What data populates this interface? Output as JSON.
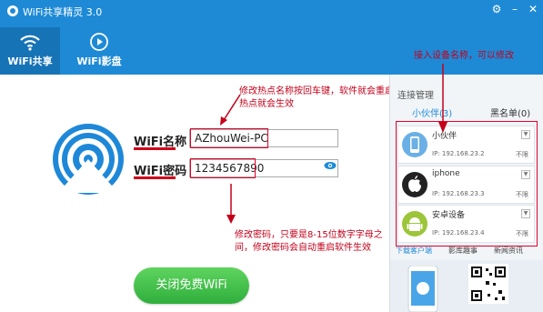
{
  "app": {
    "title": "WiFi共享精灵 3.0"
  },
  "nav": {
    "tabs": [
      {
        "label": "WiFi共享"
      },
      {
        "label": "WiFi影盘"
      }
    ]
  },
  "hotspot": {
    "name_label": "WiFi名称",
    "name_value": "AZhouWei-PC",
    "password_label": "WiFi密码",
    "password_value": "1234567890"
  },
  "annotations": {
    "name_hint": "修改热点名称按回车键，软件就会重启热点就会生效",
    "password_hint": "修改密码，只要是8-15位数字字母之间，修改密码会自动重启软件生效",
    "devices_hint": "接入设备名称，可以修改"
  },
  "actions": {
    "close_label": "关闭免费WiFi"
  },
  "panel": {
    "title": "连接管理",
    "tab_friends": "小伙伴(3)",
    "tab_blacklist": "黑名单(0)",
    "devices": [
      {
        "name": "小伙伴",
        "ip": "IP: 192.168.23.2",
        "limit": "不限",
        "icon": "phone-icon"
      },
      {
        "name": "iphone",
        "ip": "IP: 192.168.23.3",
        "limit": "不限",
        "icon": "apple-icon"
      },
      {
        "name": "安卓设备",
        "ip": "IP: 192.168.23.4",
        "limit": "不限",
        "icon": "android-icon"
      }
    ],
    "bottom_tabs": [
      "下载客户端",
      "影库趣事",
      "新闻资讯"
    ]
  },
  "colors": {
    "header": "#1e8ad6",
    "accent_red": "#c4001a",
    "button_green": "#2fae3c"
  }
}
